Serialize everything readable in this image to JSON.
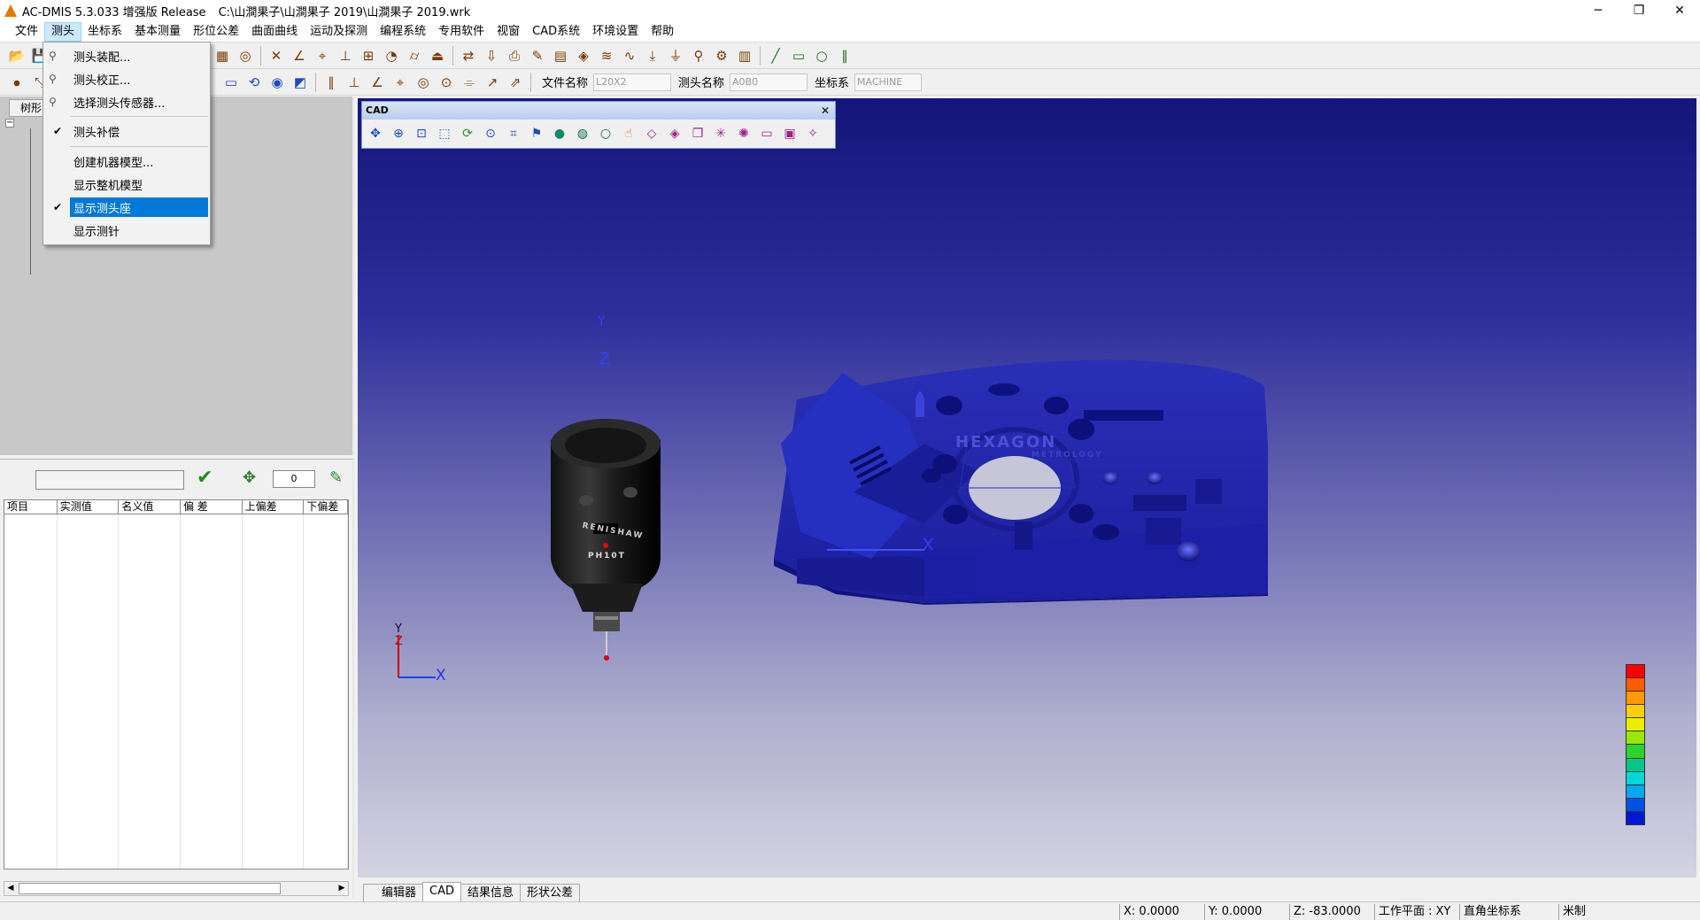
{
  "window": {
    "title": "AC-DMIS 5.3.033 增强版 Release",
    "path": "C:\\山澗果子\\山澗果子 2019\\山澗果子 2019.wrk",
    "controls": {
      "min": "─",
      "max": "❐",
      "close": "✕"
    }
  },
  "menu": [
    "文件",
    "测头",
    "坐标系",
    "基本测量",
    "形位公差",
    "曲面曲线",
    "运动及探测",
    "编程系统",
    "专用软件",
    "视窗",
    "CAD系统",
    "环境设置",
    "帮助"
  ],
  "probe_menu": {
    "items": [
      {
        "label": "测头装配...",
        "icon": "probe-icon",
        "checked": false
      },
      {
        "label": "测头校正...",
        "icon": "calibrate-icon",
        "checked": false
      },
      {
        "label": "选择测头传感器...",
        "icon": "sensor-icon",
        "checked": false
      },
      {
        "label": "测头补偿",
        "checked": true
      },
      {
        "label": "创建机器模型...",
        "checked": false
      },
      {
        "label": "显示整机模型",
        "checked": false
      },
      {
        "label": "显示测头座",
        "checked": true,
        "highlighted": true
      },
      {
        "label": "显示测针",
        "checked": false
      }
    ],
    "check_glyph": "✔"
  },
  "toolbar2": {
    "file_label": "文件名称",
    "file_value": "L20X2",
    "probe_label": "测头名称",
    "probe_value": "A0B0",
    "cs_label": "坐标系",
    "cs_value": "MACHINE"
  },
  "tree": {
    "tab": "树形",
    "expander": "−"
  },
  "results": {
    "counter": "0",
    "columns": [
      "项目",
      "实测值",
      "名义值",
      "偏 差",
      "上偏差",
      "下偏差"
    ]
  },
  "cad_toolbar": {
    "title": "CAD",
    "close": "✕"
  },
  "model": {
    "brand": "HEXAGON",
    "brand_sub": "METROLOGY",
    "probe_brand": "RENISHAW",
    "probe_model": "PH10T"
  },
  "axes": {
    "x": "X",
    "y": "Y",
    "z": "Z"
  },
  "colorbar": [
    "#ff0000",
    "#ff5a00",
    "#ff9a00",
    "#ffd000",
    "#e8f000",
    "#9ae800",
    "#2ad42a",
    "#00c88a",
    "#00d8d8",
    "#00a8f0",
    "#0050e8",
    "#0018d0"
  ],
  "tabs": [
    "编辑器",
    "CAD",
    "结果信息",
    "形状公差"
  ],
  "status": {
    "x": "X: 0.0000",
    "y": "Y: 0.0000",
    "z": "Z: -83.0000",
    "plane": "工作平面 : XY",
    "cs": "直角坐标系",
    "unit": "米制"
  }
}
